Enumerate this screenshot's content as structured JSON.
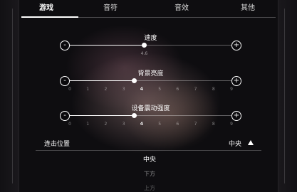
{
  "tabs": [
    {
      "label": "游戏",
      "active": true
    },
    {
      "label": "音符",
      "active": false
    },
    {
      "label": "音效",
      "active": false
    },
    {
      "label": "其他",
      "active": false
    }
  ],
  "sliders": [
    {
      "title": "速度",
      "value": "4.6",
      "position": 0.46,
      "ticks": []
    },
    {
      "title": "背景亮度",
      "value": "4",
      "position": 0.4,
      "ticks": [
        "0",
        "1",
        "2",
        "3",
        "4",
        "5",
        "6",
        "7",
        "8",
        "9"
      ]
    },
    {
      "title": "设备震动强度",
      "value": "4",
      "position": 0.4,
      "ticks": [
        "0",
        "1",
        "2",
        "3",
        "4",
        "5",
        "6",
        "7",
        "8",
        "9"
      ]
    }
  ],
  "buttons": {
    "minus": "-",
    "plus": "+"
  },
  "hit_position": {
    "label": "连击位置",
    "value": "中央",
    "options": [
      "中央",
      "下方",
      "上方"
    ]
  }
}
